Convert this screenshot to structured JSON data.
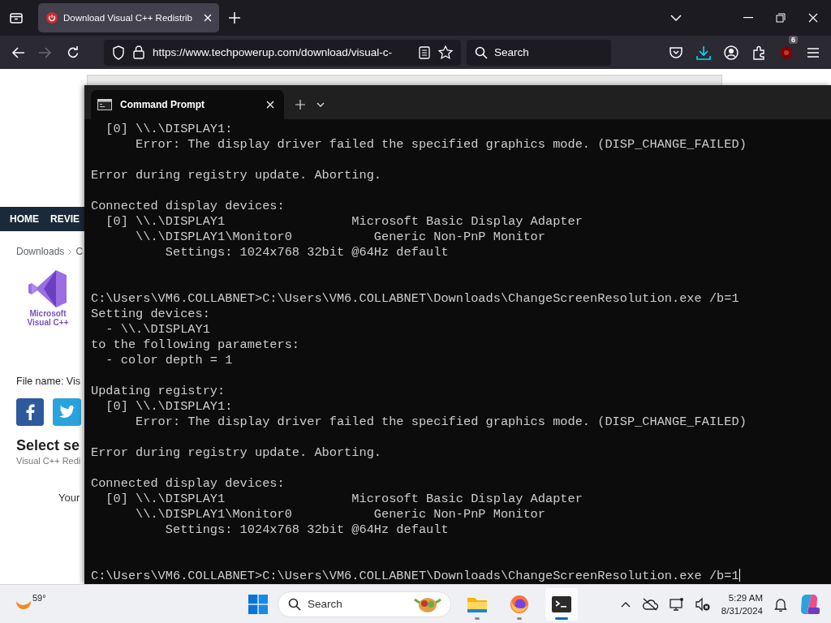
{
  "browser": {
    "tab": {
      "title": "Download Visual C++ Redistrib",
      "selected": true
    },
    "url": "https://www.techpowerup.com/download/visual-c-",
    "search": {
      "placeholder": "Search"
    },
    "extension_badge": "6"
  },
  "page": {
    "nav": [
      "HOME",
      "REVIE"
    ],
    "breadcrumb": [
      "Downloads",
      "C"
    ],
    "logo_text": [
      "Microsoft",
      "Visual C++"
    ],
    "file_name": "File name: Vis",
    "heading": "Select se",
    "subheading": "Visual C++ Redi",
    "note": "Your"
  },
  "terminal": {
    "tab_title": "Command Prompt",
    "lines": [
      {
        "kind": "text",
        "text": "  [0] \\\\.\\DISPLAY1:",
        "cursor": false
      },
      {
        "kind": "text",
        "text": "      Error: The display driver failed the specified graphics mode. (DISP_CHANGE_FAILED)",
        "cursor": false
      },
      {
        "kind": "blank"
      },
      {
        "kind": "text",
        "text": "Error during registry update. Aborting.",
        "cursor": false
      },
      {
        "kind": "blank"
      },
      {
        "kind": "text",
        "text": "Connected display devices:",
        "cursor": false
      },
      {
        "kind": "text",
        "text": "  [0] \\\\.\\DISPLAY1                 Microsoft Basic Display Adapter",
        "cursor": false
      },
      {
        "kind": "text",
        "text": "      \\\\.\\DISPLAY1\\Monitor0           Generic Non-PnP Monitor",
        "cursor": false
      },
      {
        "kind": "text",
        "text": "          Settings: 1024x768 32bit @64Hz default",
        "cursor": false
      },
      {
        "kind": "blank"
      },
      {
        "kind": "blank"
      },
      {
        "kind": "text",
        "text": "C:\\Users\\VM6.COLLABNET>C:\\Users\\VM6.COLLABNET\\Downloads\\ChangeScreenResolution.exe /b=1",
        "cursor": false
      },
      {
        "kind": "text",
        "text": "Setting devices:",
        "cursor": false
      },
      {
        "kind": "text",
        "text": "  - \\\\.\\DISPLAY1",
        "cursor": false
      },
      {
        "kind": "text",
        "text": "to the following parameters:",
        "cursor": false
      },
      {
        "kind": "text",
        "text": "  - color depth = 1",
        "cursor": false
      },
      {
        "kind": "blank"
      },
      {
        "kind": "text",
        "text": "Updating registry:",
        "cursor": false
      },
      {
        "kind": "text",
        "text": "  [0] \\\\.\\DISPLAY1:",
        "cursor": false
      },
      {
        "kind": "text",
        "text": "      Error: The display driver failed the specified graphics mode. (DISP_CHANGE_FAILED)",
        "cursor": false
      },
      {
        "kind": "blank"
      },
      {
        "kind": "text",
        "text": "Error during registry update. Aborting.",
        "cursor": false
      },
      {
        "kind": "blank"
      },
      {
        "kind": "text",
        "text": "Connected display devices:",
        "cursor": false
      },
      {
        "kind": "text",
        "text": "  [0] \\\\.\\DISPLAY1                 Microsoft Basic Display Adapter",
        "cursor": false
      },
      {
        "kind": "text",
        "text": "      \\\\.\\DISPLAY1\\Monitor0           Generic Non-PnP Monitor",
        "cursor": false
      },
      {
        "kind": "text",
        "text": "          Settings: 1024x768 32bit @64Hz default",
        "cursor": false
      },
      {
        "kind": "blank"
      },
      {
        "kind": "blank"
      },
      {
        "kind": "text",
        "text": "C:\\Users\\VM6.COLLABNET>C:\\Users\\VM6.COLLABNET\\Downloads\\ChangeScreenResolution.exe /b=1",
        "cursor": true
      }
    ]
  },
  "taskbar": {
    "weather": "59°",
    "search": {
      "placeholder": "Search"
    },
    "apps": [
      {
        "kind": "files",
        "selected": false
      },
      {
        "kind": "browser",
        "selected": false
      },
      {
        "kind": "terminal",
        "selected": true
      }
    ],
    "time": "5:29 AM",
    "date": "8/31/2024"
  }
}
